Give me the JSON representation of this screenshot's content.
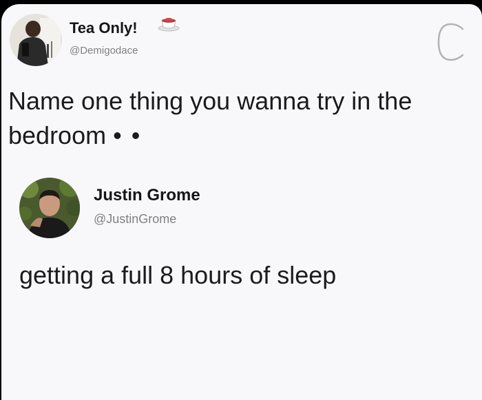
{
  "post": {
    "author_name": "Tea Only!",
    "author_handle": "@Demigodace",
    "name_icon": "teacup-icon",
    "corner_logo": "c-logo-icon",
    "text": "Name one thing you wanna try in the bedroom",
    "text_suffix": "• •"
  },
  "reply": {
    "author_name": "Justin Grome",
    "author_handle": "@JustinGrome",
    "text": "getting a full 8 hours of sleep"
  },
  "colors": {
    "background": "#f8f8fa",
    "frame": "#000000",
    "text": "#1b1b1b",
    "handle": "#7f7f84"
  }
}
